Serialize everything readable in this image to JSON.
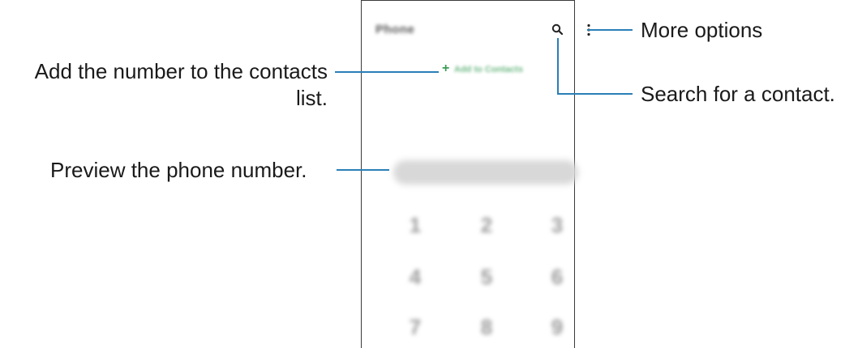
{
  "phone_screen": {
    "app_title": "Phone",
    "add_to_contacts_label": "Add to Contacts",
    "search_icon": "search-icon",
    "more_icon": "more-options-icon",
    "keypad": [
      "1",
      "2",
      "3",
      "4",
      "5",
      "6",
      "7",
      "8",
      "9"
    ]
  },
  "callouts": {
    "more_options": "More options",
    "add_number": "Add the number to the contacts",
    "add_number_line2": "list.",
    "search_contact": "Search for a contact.",
    "preview_number": "Preview the phone number."
  },
  "colors": {
    "callout_line": "#2a7fb8",
    "accent_green": "#3b9b57"
  }
}
